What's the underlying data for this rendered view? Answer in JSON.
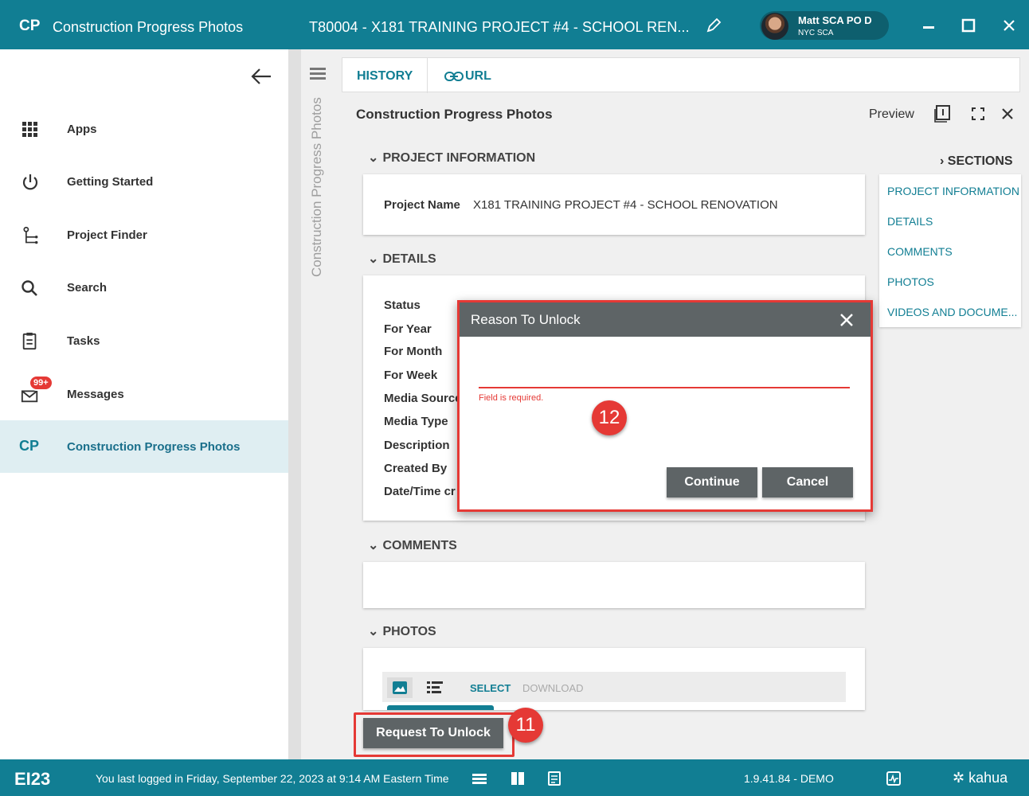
{
  "topbar": {
    "logo": "CP",
    "app_title": "Construction Progress Photos",
    "project_title": "T80004 - X181 TRAINING PROJECT #4 - SCHOOL REN...",
    "user_name": "Matt SCA PO D",
    "user_org": "NYC SCA",
    "accent_color": "#117e93"
  },
  "sidebar": {
    "items": [
      {
        "label": "Apps",
        "icon": "apps-grid-icon"
      },
      {
        "label": "Getting Started",
        "icon": "power-icon"
      },
      {
        "label": "Project Finder",
        "icon": "project-tree-icon"
      },
      {
        "label": "Search",
        "icon": "search-icon"
      },
      {
        "label": "Tasks",
        "icon": "clipboard-icon"
      },
      {
        "label": "Messages",
        "icon": "mail-icon",
        "badge": "99+"
      },
      {
        "label": "Construction Progress Photos",
        "icon": "CP",
        "active": true
      }
    ]
  },
  "panel": {
    "vertical_title": "Construction Progress Photos"
  },
  "tabs": {
    "history": "HISTORY",
    "url": "URL"
  },
  "content": {
    "title": "Construction Progress Photos",
    "preview": "Preview",
    "sections_label": "SECTIONS",
    "section_links": [
      "PROJECT INFORMATION",
      "DETAILS",
      "COMMENTS",
      "PHOTOS",
      "VIDEOS AND DOCUME..."
    ],
    "project_info_header": "PROJECT INFORMATION",
    "project_name_label": "Project Name",
    "project_name_value": "X181 TRAINING PROJECT #4 - SCHOOL RENOVATION",
    "details_header": "DETAILS",
    "details_fields": [
      "Status",
      "For Year",
      "For Month",
      "For Week",
      "Media Source",
      "Media Type",
      "Description",
      "Created By",
      "Date/Time cr"
    ],
    "comments_header": "COMMENTS",
    "photos_header": "PHOTOS",
    "photos_select": "SELECT",
    "photos_download": "DOWNLOAD",
    "request_unlock": "Request To Unlock"
  },
  "dialog": {
    "title": "Reason To Unlock",
    "input_value": "",
    "error": "Field is required.",
    "continue": "Continue",
    "cancel": "Cancel"
  },
  "callouts": {
    "c11": "11",
    "c12": "12"
  },
  "statusbar": {
    "ei": "EI23",
    "last_login": "You last logged in Friday, September 22, 2023 at 9:14 AM Eastern Time",
    "version": "1.9.41.84 - DEMO",
    "brand": "kahua"
  }
}
